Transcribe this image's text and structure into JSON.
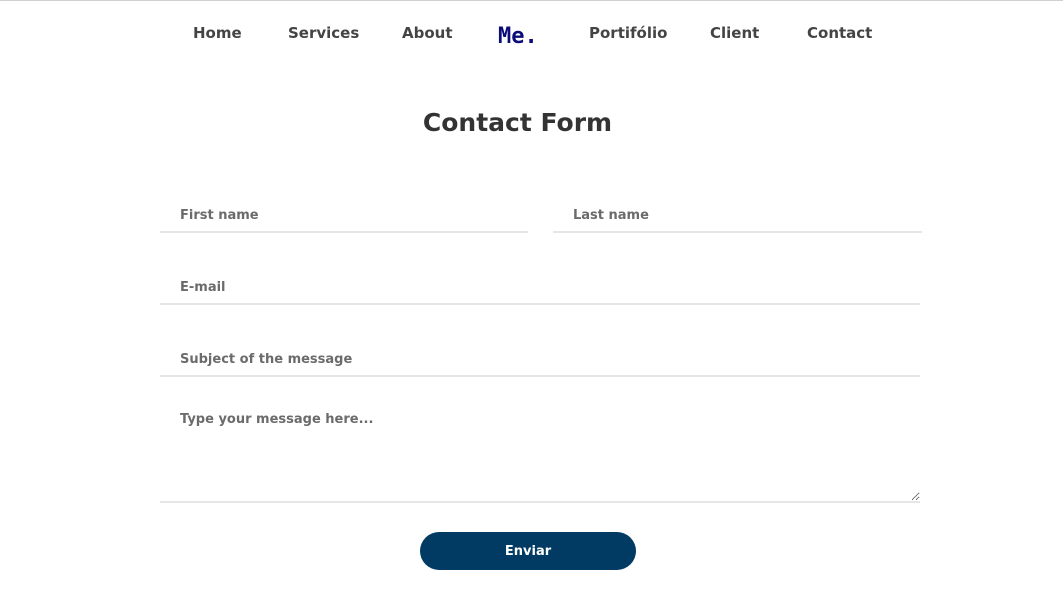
{
  "nav": {
    "items": [
      {
        "label": "Home"
      },
      {
        "label": "Services"
      },
      {
        "label": "About"
      },
      {
        "label": "Portifólio"
      },
      {
        "label": "Client"
      },
      {
        "label": "Contact"
      }
    ],
    "logo": "Me.",
    "colors": {
      "logo": "#0b0b7a",
      "text": "#444444"
    }
  },
  "form": {
    "title": "Contact Form",
    "first_name_placeholder": "First name",
    "last_name_placeholder": "Last name",
    "email_placeholder": "E-mail",
    "subject_placeholder": "Subject of the message",
    "message_placeholder": "Type your message here...",
    "submit_label": "Enviar",
    "colors": {
      "button": "#013a63",
      "button_text": "#ffffff",
      "underline": "#e6e6e6"
    }
  }
}
